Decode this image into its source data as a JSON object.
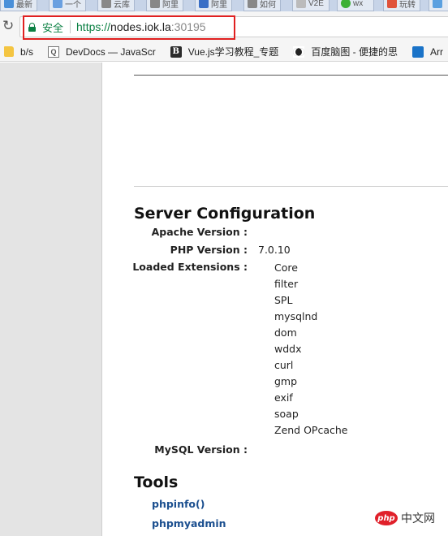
{
  "browser": {
    "tabs": [
      {
        "title": "最新",
        "icon": "doc-icon",
        "color": "#4a90d9"
      },
      {
        "title": "一个",
        "icon": "grid-icon",
        "color": "#6aa0e0"
      },
      {
        "title": "云库",
        "icon": "puzzle-icon",
        "color": "#888888"
      },
      {
        "title": "阿里",
        "icon": "puzzle-icon",
        "color": "#888888"
      },
      {
        "title": "阿里",
        "icon": "house-icon",
        "color": "#3a6fc6"
      },
      {
        "title": "如何",
        "icon": "puzzle-icon",
        "color": "#888888"
      },
      {
        "title": "V2E",
        "icon": "diamond-icon",
        "color": "#bbbbbb"
      },
      {
        "title": "wx",
        "icon": "wechat-icon",
        "color": "#3cb034"
      },
      {
        "title": "玩转",
        "icon": "w-icon",
        "color": "#e0523a"
      },
      {
        "title": "",
        "icon": "arrow-icon",
        "color": "#5aa0e0"
      }
    ],
    "address": {
      "secure_label": "安全",
      "scheme": "https://",
      "host": "nodes.iok.la",
      "port": ":30195"
    },
    "bookmarks": [
      {
        "label": "b/s",
        "icon": "folder-icon"
      },
      {
        "label": "DevDocs — JavaScr",
        "icon": "magnifier-icon"
      },
      {
        "label": "Vue.js学习教程_专题",
        "icon": "b-icon"
      },
      {
        "label": "百度脑图 - 便捷的思",
        "icon": "owl-icon"
      },
      {
        "label": "Arr",
        "icon": "app-icon"
      }
    ]
  },
  "page": {
    "server_config": {
      "heading": "Server Configuration",
      "apache_label": "Apache Version :",
      "apache_value": "",
      "php_label": "PHP Version :",
      "php_value": "7.0.10",
      "extensions_label": "Loaded Extensions :",
      "extensions": [
        "Core",
        "filter",
        "SPL",
        "mysqlnd",
        "dom",
        "wddx",
        "curl",
        "gmp",
        "exif",
        "soap",
        "Zend OPcache"
      ],
      "mysql_label": "MySQL Version :",
      "mysql_value": ""
    },
    "tools": {
      "heading": "Tools",
      "links": [
        "phpinfo()",
        "phpmyadmin"
      ]
    }
  },
  "watermark": {
    "badge": "php",
    "text": "中文网"
  },
  "colors": {
    "secure_green": "#0b8043",
    "highlight_red": "#e02020",
    "link_blue": "#1b4f8f",
    "sidebar_grey": "#e4e4e4"
  }
}
